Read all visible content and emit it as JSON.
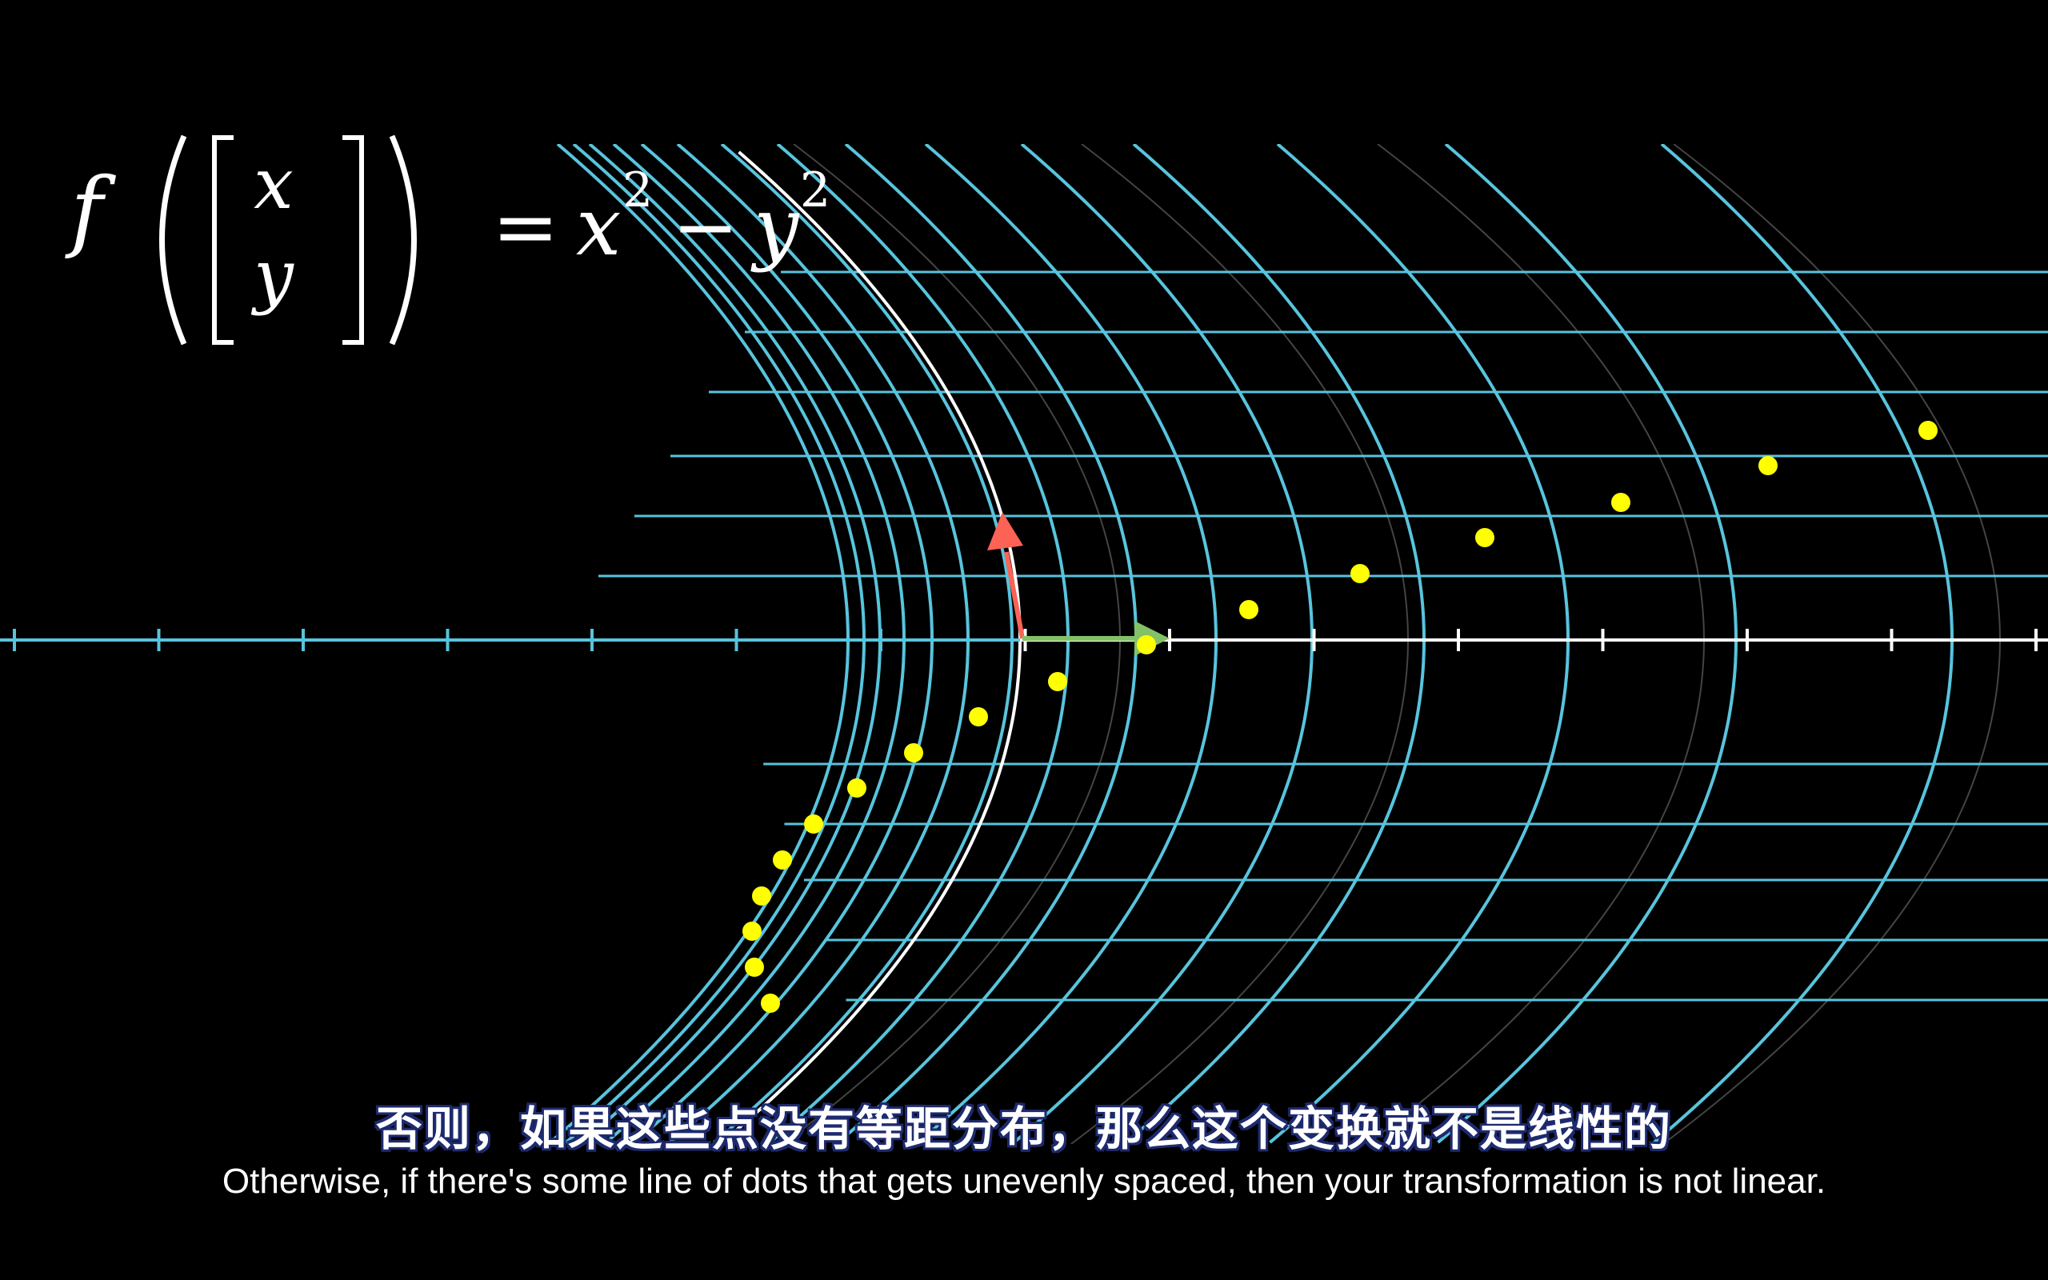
{
  "formula": {
    "f": "f",
    "x": "x",
    "y": "y",
    "equals": "=",
    "rhs_x": "x",
    "exp1": "2",
    "minus": "−",
    "rhs_y": "y",
    "exp2": "2"
  },
  "subtitles": {
    "chinese": "否则，如果这些点没有等距分布，那么这个变换就不是线性的",
    "english": "Otherwise, if there's some line of dots that gets unevenly spaced, then your transformation is not linear."
  },
  "colors": {
    "background": "#000000",
    "grid_blue": "#58c4dd",
    "faint_grid": "#444444",
    "axis_highlight": "#ffffff",
    "dot_yellow": "#ffff00",
    "vector_red": "#fc6255",
    "vector_green": "#83c167"
  },
  "icons": {
    "red_vector": "arrow-up-icon",
    "green_vector": "arrow-right-icon"
  }
}
